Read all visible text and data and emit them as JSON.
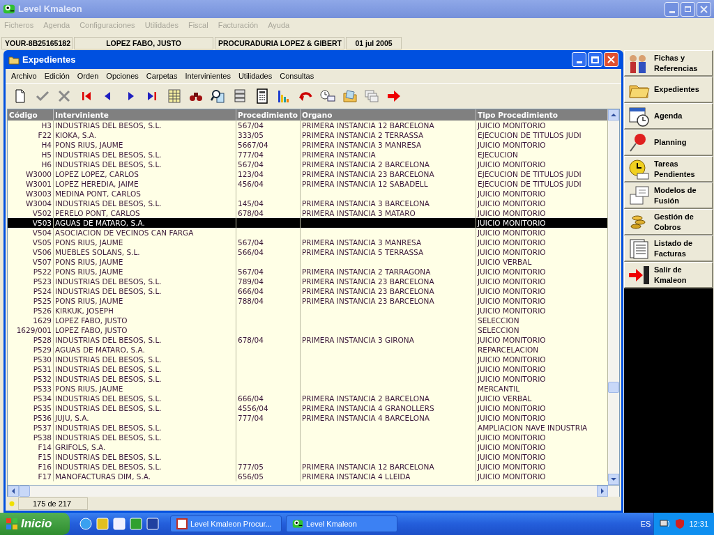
{
  "app": {
    "title": "Level Kmaleon",
    "menu": [
      "Ficheros",
      "Agenda",
      "Configuraciones",
      "Utilidades",
      "Fiscal",
      "Facturación",
      "Ayuda"
    ],
    "info_bar": [
      "YOUR-8B25165182",
      "LOPEZ FABO, JUSTO",
      "PROCURADURIA LOPEZ & GIBERT",
      "01 jul 2005"
    ]
  },
  "window": {
    "title": "Expedientes",
    "menu": [
      "Archivo",
      "Edición",
      "Orden",
      "Opciones",
      "Carpetas",
      "Intervinientes",
      "Utilidades",
      "Consultas"
    ]
  },
  "table": {
    "columns": [
      "Código",
      "Interviniente",
      "Procedimiento",
      "Organo",
      "Tipo Procedimiento"
    ],
    "rows": [
      {
        "cells": [
          "H3",
          "INDUSTRIAS DEL BESOS, S.L.",
          "567/04",
          "PRIMERA INSTANCIA 12 BARCELONA",
          "JUICIO MONITORIO"
        ],
        "selected": false
      },
      {
        "cells": [
          "F22",
          "KIOKA, S.A.",
          "333/05",
          "PRIMERA INSTANCIA 2 TERRASSA",
          "EJECUCION DE TITULOS JUDI"
        ],
        "selected": false
      },
      {
        "cells": [
          "H4",
          "PONS RIUS, JAUME",
          "5667/04",
          "PRIMERA INSTANCIA 3 MANRESA",
          "JUICIO MONITORIO"
        ],
        "selected": false
      },
      {
        "cells": [
          "H5",
          "INDUSTRIAS DEL BESOS, S.L.",
          "777/04",
          "PRIMERA INSTANCIA",
          "EJECUCION"
        ],
        "selected": false
      },
      {
        "cells": [
          "H6",
          "INDUSTRIAS DEL BESOS, S.L.",
          "567/04",
          "PRIMERA INSTANCIA 2 BARCELONA",
          "JUICIO MONITORIO"
        ],
        "selected": false
      },
      {
        "cells": [
          "W3000",
          "LOPEZ LOPEZ, CARLOS",
          "123/04",
          "PRIMERA INSTANCIA 23 BARCELONA",
          "EJECUCION DE TITULOS JUDI"
        ],
        "selected": false
      },
      {
        "cells": [
          "W3001",
          "LOPEZ HEREDIA, JAIME",
          "456/04",
          "PRIMERA INSTANCIA 12 SABADELL",
          "EJECUCION DE TITULOS JUDI"
        ],
        "selected": false
      },
      {
        "cells": [
          "W3003",
          "MEDINA PONT, CARLOS",
          "",
          "",
          "JUICIO MONITORIO"
        ],
        "selected": false
      },
      {
        "cells": [
          "W3004",
          "INDUSTRIAS DEL BESOS, S.L.",
          "145/04",
          "PRIMERA INSTANCIA 3 BARCELONA",
          "JUICIO MONITORIO"
        ],
        "selected": false
      },
      {
        "cells": [
          "V502",
          "PERELO PONT, CARLOS",
          "678/04",
          "PRIMERA INSTANCIA 3 MATARO",
          "JUICIO MONITORIO"
        ],
        "selected": false
      },
      {
        "cells": [
          "V503",
          "AGUAS DE MATARO, S.A.",
          "",
          "",
          "JUICIO MONITORIO"
        ],
        "selected": true
      },
      {
        "cells": [
          "V504",
          "ASOCIACION DE VECINOS CAN FARGA",
          "",
          "",
          "JUICIO MONITORIO"
        ],
        "selected": false
      },
      {
        "cells": [
          "V505",
          "PONS RIUS, JAUME",
          "567/04",
          "PRIMERA INSTANCIA 3 MANRESA",
          "JUICIO MONITORIO"
        ],
        "selected": false
      },
      {
        "cells": [
          "V506",
          "MUEBLES SOLANS, S.L.",
          "566/04",
          "PRIMERA INSTANCIA 5 TERRASSA",
          "JUICIO MONITORIO"
        ],
        "selected": false
      },
      {
        "cells": [
          "V507",
          "PONS RIUS, JAUME",
          "",
          "",
          "JUICIO VERBAL"
        ],
        "selected": false
      },
      {
        "cells": [
          "P522",
          "PONS RIUS, JAUME",
          "567/04",
          "PRIMERA INSTANCIA 2 TARRAGONA",
          "JUICIO MONITORIO"
        ],
        "selected": false
      },
      {
        "cells": [
          "P523",
          "INDUSTRIAS DEL BESOS, S.L.",
          "789/04",
          "PRIMERA INSTANCIA 23 BARCELONA",
          "JUICIO MONITORIO"
        ],
        "selected": false
      },
      {
        "cells": [
          "P524",
          "INDUSTRIAS DEL BESOS, S.L.",
          "666/04",
          "PRIMERA INSTANCIA 23 BARCELONA",
          "JUICIO MONITORIO"
        ],
        "selected": false
      },
      {
        "cells": [
          "P525",
          "PONS RIUS, JAUME",
          "788/04",
          "PRIMERA INSTANCIA 23 BARCELONA",
          "JUICIO MONITORIO"
        ],
        "selected": false
      },
      {
        "cells": [
          "P526",
          "KIRKUK, JOSEPH",
          "",
          "",
          "JUICIO MONITORIO"
        ],
        "selected": false
      },
      {
        "cells": [
          "1629",
          "LOPEZ FABO, JUSTO",
          "",
          "",
          "SELECCION"
        ],
        "selected": false
      },
      {
        "cells": [
          "1629/001",
          "LOPEZ FABO, JUSTO",
          "",
          "",
          "SELECCION"
        ],
        "selected": false
      },
      {
        "cells": [
          "P528",
          "INDUSTRIAS DEL BESOS, S.L.",
          "678/04",
          "PRIMERA INSTANCIA 3 GIRONA",
          "JUICIO MONITORIO"
        ],
        "selected": false
      },
      {
        "cells": [
          "P529",
          "AGUAS DE MATARO, S.A.",
          "",
          "",
          "REPARCELACION"
        ],
        "selected": false
      },
      {
        "cells": [
          "P530",
          "INDUSTRIAS DEL BESOS, S.L.",
          "",
          "",
          "JUICIO MONITORIO"
        ],
        "selected": false
      },
      {
        "cells": [
          "P531",
          "INDUSTRIAS DEL BESOS, S.L.",
          "",
          "",
          "JUICIO MONITORIO"
        ],
        "selected": false
      },
      {
        "cells": [
          "P532",
          "INDUSTRIAS DEL BESOS, S.L.",
          "",
          "",
          "JUICIO MONITORIO"
        ],
        "selected": false
      },
      {
        "cells": [
          "P533",
          "PONS RIUS, JAUME",
          "",
          "",
          "MERCANTIL"
        ],
        "selected": false
      },
      {
        "cells": [
          "P534",
          "INDUSTRIAS DEL BESOS, S.L.",
          "666/04",
          "PRIMERA INSTANCIA 2 BARCELONA",
          "JUICIO VERBAL"
        ],
        "selected": false
      },
      {
        "cells": [
          "P535",
          "INDUSTRIAS DEL BESOS, S.L.",
          "4556/04",
          "PRIMERA INSTANCIA 4 GRANOLLERS",
          "JUICIO MONITORIO"
        ],
        "selected": false
      },
      {
        "cells": [
          "P536",
          "JUJU, S.A.",
          "777/04",
          "PRIMERA INSTANCIA 4 BARCELONA",
          "JUICIO MONITORIO"
        ],
        "selected": false
      },
      {
        "cells": [
          "P537",
          "INDUSTRIAS DEL BESOS, S.L.",
          "",
          "",
          "AMPLIACION NAVE INDUSTRIA"
        ],
        "selected": false
      },
      {
        "cells": [
          "P538",
          "INDUSTRIAS DEL BESOS, S.L.",
          "",
          "",
          "JUICIO MONITORIO"
        ],
        "selected": false
      },
      {
        "cells": [
          "F14",
          "GRIFOLS, S.A.",
          "",
          "",
          "JUICIO MONITORIO"
        ],
        "selected": false
      },
      {
        "cells": [
          "F15",
          "INDUSTRIAS DEL BESOS, S.L.",
          "",
          "",
          "JUICIO MONITORIO"
        ],
        "selected": false
      },
      {
        "cells": [
          "F16",
          "INDUSTRIAS DEL BESOS, S.L.",
          "777/05",
          "PRIMERA INSTANCIA 12 BARCELONA",
          "JUICIO MONITORIO"
        ],
        "selected": false
      },
      {
        "cells": [
          "F17",
          "MANOFACTURAS DIM, S.A.",
          "656/05",
          "PRIMERA INSTANCIA 4 LLEIDA",
          "JUICIO MONITORIO"
        ],
        "selected": false
      }
    ]
  },
  "status_bar": {
    "count": "175 de 217"
  },
  "sidebar": {
    "items": [
      "Fichas y Referencias",
      "Expedientes",
      "Agenda",
      "Planning",
      "Tareas Pendientes",
      "Modelos de Fusión",
      "Gestión de Cobros",
      "Listado de Facturas",
      "Salir de Kmaleon"
    ]
  },
  "taskbar": {
    "start": "Inicio",
    "tasks": [
      "Level Kmaleon Procur...",
      "Level Kmaleon"
    ],
    "language": "ES",
    "clock": "12:31"
  }
}
